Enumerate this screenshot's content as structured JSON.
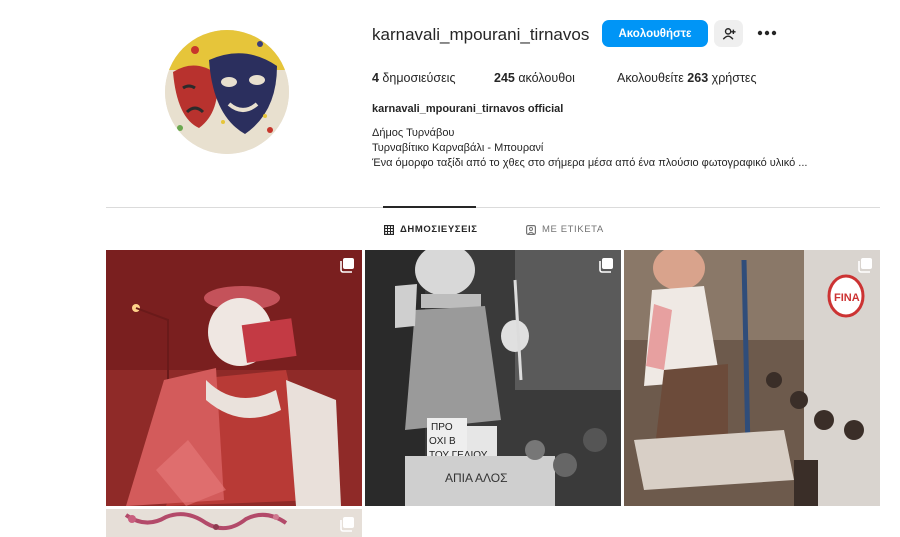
{
  "profile": {
    "username": "karnavali_mpourani_tirnavos",
    "follow_label": "Ακολουθήστε",
    "suggest_icon": "add-person-icon",
    "more_icon": "more-icon",
    "posts_count": "4",
    "posts_label": " δημοσιεύσεις",
    "followers_count": "245",
    "followers_label": " ακόλουθοι",
    "following_prefix": "Ακολουθείτε ",
    "following_count": "263",
    "following_suffix": " χρήστες",
    "full_name": "karnavali_mpourani_tirnavos official",
    "bio_lines": [
      "Δήμος Τυρνάβου",
      "Τυρναβίτικο Καρναβάλι - Μπουρανί",
      "Ένα όμορφο ταξίδι από το χθες στο σήμερα μέσα από ένα πλούσιο φωτογραφικό υλικό ..."
    ]
  },
  "tabs": {
    "posts": {
      "label": "ΔΗΜΟΣΙΕΥΣΕΙΣ",
      "icon": "grid-icon"
    },
    "tagged": {
      "label": "ΜΕ ΕΤΙΚΕΤΑ",
      "icon": "tag-person-icon"
    }
  },
  "grid": {
    "tile_2_sign_top": "ΠΡΟ",
    "tile_2_sign_mid": "ΟΧΙ Β",
    "tile_2_sign_bottom": "ΤΟΥ ΓΕΛΙΟΥ",
    "tile_2_banner": "ΑΠΙΑ ΑΛΟΣ",
    "tile_3_sign": "FINA",
    "multi_icon": "carousel-icon"
  },
  "colors": {
    "accent": "#0095f6",
    "text": "#262626",
    "muted": "#737373",
    "divider": "#dbdbdb"
  }
}
